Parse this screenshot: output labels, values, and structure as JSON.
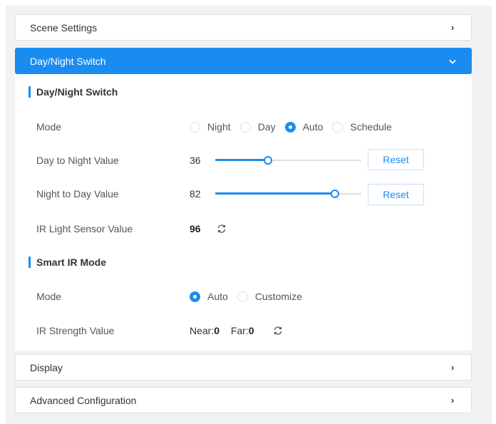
{
  "accordion": {
    "scene_settings": "Scene Settings",
    "day_night_switch": "Day/Night Switch",
    "display": "Display",
    "advanced_configuration": "Advanced Configuration",
    "chevron_collapsed": "›",
    "chevron_expanded": "⌄"
  },
  "day_night": {
    "section_title": "Day/Night Switch",
    "mode_label": "Mode",
    "mode_options": [
      "Night",
      "Day",
      "Auto",
      "Schedule"
    ],
    "mode_selected": "Auto",
    "day_to_night_label": "Day to Night Value",
    "day_to_night_value": "36",
    "day_to_night_fraction": 0.36,
    "night_to_day_label": "Night to Day Value",
    "night_to_day_value": "82",
    "night_to_day_fraction": 0.82,
    "reset_label": "Reset",
    "ir_light_sensor_label": "IR Light Sensor Value",
    "ir_light_sensor_value": "96"
  },
  "smart_ir": {
    "section_title": "Smart IR Mode",
    "mode_label": "Mode",
    "mode_options": [
      "Auto",
      "Customize"
    ],
    "mode_selected": "Auto",
    "ir_strength_label": "IR Strength Value",
    "near_label": "Near:",
    "near_value": "0",
    "far_label": "Far:",
    "far_value": "0"
  },
  "colors": {
    "accent": "#1a8cf0",
    "background": "#f1f2f4",
    "border": "#dcdfe6"
  }
}
